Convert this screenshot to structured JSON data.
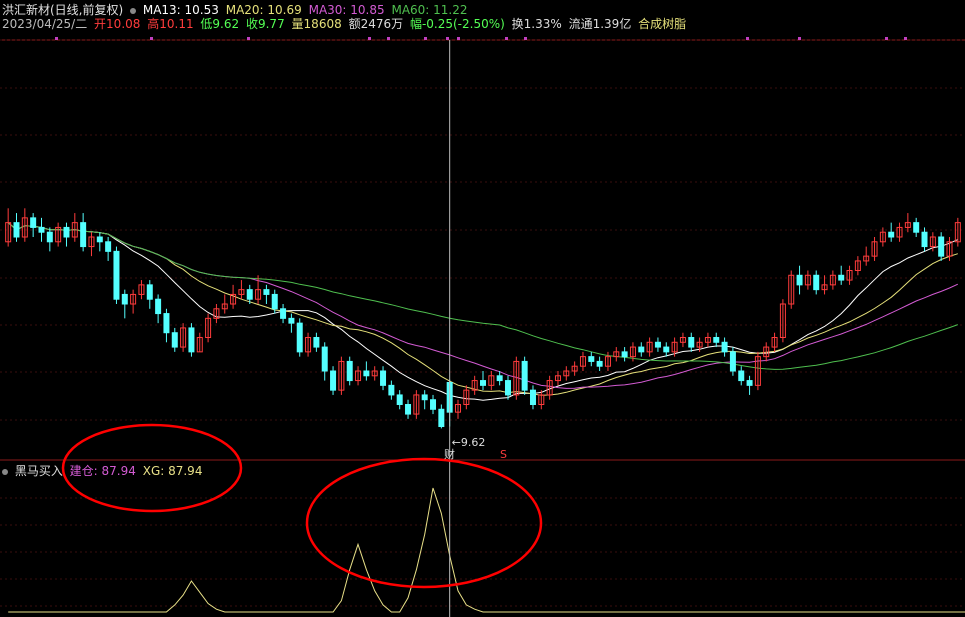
{
  "header": {
    "stock_name": "洪汇新材(日线,前复权)",
    "ma13": "MA13: 10.53",
    "ma20": "MA20: 10.69",
    "ma30": "MA30: 10.85",
    "ma60": "MA60: 11.22",
    "date": "2023/04/25/二",
    "open": "开10.08",
    "high": "高10.11",
    "low": "低9.62",
    "close": "收9.77",
    "volume": "量18608",
    "amount": "额2476万",
    "change": "幅-0.25(-2.50%)",
    "turnover": "换1.33%",
    "float_cap": "流通1.39亿",
    "industry": "合成树脂"
  },
  "markers": {
    "low_label": "←9.62",
    "marker_cai": "财",
    "marker_s": "S"
  },
  "indicator": {
    "name": "黑马买入",
    "jiancang": "建仓: 87.94",
    "xg": "XG: 87.94"
  },
  "colors": {
    "up": "#ff3c3c",
    "down": "#54ffff",
    "ma13": "#ffffff",
    "ma20": "#e5e07a",
    "ma30": "#d35bd3",
    "ma60": "#4fbf4f",
    "indicator_line": "#e8e088",
    "annotation": "#ff0000"
  },
  "chart_data": {
    "type": "candlestick",
    "price_range": [
      9.5,
      12.3
    ],
    "candles": [
      [
        11.55,
        11.75,
        11.9,
        11.5
      ],
      [
        11.75,
        11.6,
        11.85,
        11.55
      ],
      [
        11.6,
        11.8,
        11.9,
        11.55
      ],
      [
        11.8,
        11.7,
        11.85,
        11.6
      ],
      [
        11.7,
        11.65,
        11.8,
        11.55
      ],
      [
        11.65,
        11.55,
        11.7,
        11.45
      ],
      [
        11.55,
        11.7,
        11.75,
        11.5
      ],
      [
        11.7,
        11.6,
        11.75,
        11.5
      ],
      [
        11.6,
        11.75,
        11.85,
        11.55
      ],
      [
        11.75,
        11.5,
        11.85,
        11.45
      ],
      [
        11.5,
        11.6,
        11.65,
        11.4
      ],
      [
        11.6,
        11.55,
        11.65,
        11.45
      ],
      [
        11.55,
        11.45,
        11.6,
        11.35
      ],
      [
        11.45,
        10.95,
        11.5,
        10.9
      ],
      [
        11.0,
        10.9,
        11.05,
        10.75
      ],
      [
        10.9,
        11.0,
        11.05,
        10.8
      ],
      [
        11.0,
        11.1,
        11.15,
        10.95
      ],
      [
        11.1,
        10.95,
        11.15,
        10.85
      ],
      [
        10.95,
        10.8,
        11.0,
        10.7
      ],
      [
        10.8,
        10.6,
        10.85,
        10.5
      ],
      [
        10.6,
        10.45,
        10.65,
        10.4
      ],
      [
        10.45,
        10.65,
        10.7,
        10.4
      ],
      [
        10.65,
        10.4,
        10.7,
        10.35
      ],
      [
        10.4,
        10.55,
        10.6,
        10.4
      ],
      [
        10.55,
        10.75,
        10.8,
        10.5
      ],
      [
        10.75,
        10.85,
        10.9,
        10.7
      ],
      [
        10.85,
        10.9,
        11.0,
        10.8
      ],
      [
        10.9,
        11.0,
        11.1,
        10.85
      ],
      [
        11.0,
        11.05,
        11.15,
        10.95
      ],
      [
        11.05,
        10.95,
        11.1,
        10.9
      ],
      [
        10.95,
        11.05,
        11.2,
        10.9
      ],
      [
        11.05,
        11.0,
        11.1,
        10.9
      ],
      [
        11.0,
        10.85,
        11.05,
        10.8
      ],
      [
        10.85,
        10.75,
        10.9,
        10.7
      ],
      [
        10.75,
        10.7,
        10.8,
        10.6
      ],
      [
        10.7,
        10.4,
        10.75,
        10.35
      ],
      [
        10.4,
        10.55,
        10.6,
        10.35
      ],
      [
        10.55,
        10.45,
        10.6,
        10.4
      ],
      [
        10.45,
        10.2,
        10.5,
        10.1
      ],
      [
        10.2,
        10.0,
        10.25,
        9.95
      ],
      [
        10.0,
        10.3,
        10.35,
        9.95
      ],
      [
        10.3,
        10.1,
        10.35,
        10.05
      ],
      [
        10.1,
        10.2,
        10.25,
        10.05
      ],
      [
        10.2,
        10.15,
        10.3,
        10.1
      ],
      [
        10.15,
        10.2,
        10.25,
        10.1
      ],
      [
        10.2,
        10.05,
        10.25,
        10.0
      ],
      [
        10.05,
        9.95,
        10.1,
        9.9
      ],
      [
        9.95,
        9.85,
        10.0,
        9.8
      ],
      [
        9.85,
        9.75,
        9.9,
        9.7
      ],
      [
        9.75,
        9.95,
        10.0,
        9.7
      ],
      [
        9.95,
        9.9,
        10.0,
        9.8
      ],
      [
        9.9,
        9.8,
        9.95,
        9.75
      ],
      [
        9.8,
        9.62,
        9.85,
        9.6
      ],
      [
        10.08,
        9.77,
        10.11,
        9.62
      ],
      [
        9.77,
        9.85,
        9.9,
        9.7
      ],
      [
        9.85,
        10.0,
        10.05,
        9.8
      ],
      [
        10.0,
        10.1,
        10.15,
        9.95
      ],
      [
        10.1,
        10.05,
        10.2,
        10.0
      ],
      [
        10.05,
        10.15,
        10.2,
        10.0
      ],
      [
        10.15,
        10.1,
        10.2,
        10.05
      ],
      [
        10.1,
        9.95,
        10.15,
        9.9
      ],
      [
        9.95,
        10.3,
        10.35,
        9.9
      ],
      [
        10.3,
        10.0,
        10.35,
        9.95
      ],
      [
        10.0,
        9.85,
        10.05,
        9.8
      ],
      [
        9.85,
        9.95,
        10.0,
        9.8
      ],
      [
        9.95,
        10.1,
        10.15,
        9.9
      ],
      [
        10.1,
        10.15,
        10.2,
        10.05
      ],
      [
        10.15,
        10.2,
        10.25,
        10.1
      ],
      [
        10.2,
        10.25,
        10.3,
        10.15
      ],
      [
        10.25,
        10.35,
        10.4,
        10.2
      ],
      [
        10.35,
        10.3,
        10.4,
        10.25
      ],
      [
        10.3,
        10.25,
        10.35,
        10.2
      ],
      [
        10.25,
        10.35,
        10.4,
        10.2
      ],
      [
        10.35,
        10.4,
        10.45,
        10.3
      ],
      [
        10.4,
        10.35,
        10.45,
        10.3
      ],
      [
        10.35,
        10.45,
        10.5,
        10.3
      ],
      [
        10.45,
        10.4,
        10.5,
        10.35
      ],
      [
        10.4,
        10.5,
        10.55,
        10.35
      ],
      [
        10.5,
        10.45,
        10.55,
        10.4
      ],
      [
        10.45,
        10.4,
        10.5,
        10.35
      ],
      [
        10.4,
        10.5,
        10.55,
        10.35
      ],
      [
        10.5,
        10.55,
        10.6,
        10.45
      ],
      [
        10.55,
        10.45,
        10.6,
        10.4
      ],
      [
        10.45,
        10.5,
        10.55,
        10.4
      ],
      [
        10.5,
        10.55,
        10.6,
        10.45
      ],
      [
        10.55,
        10.5,
        10.6,
        10.45
      ],
      [
        10.5,
        10.4,
        10.55,
        10.35
      ],
      [
        10.4,
        10.2,
        10.45,
        10.15
      ],
      [
        10.2,
        10.1,
        10.25,
        10.05
      ],
      [
        10.1,
        10.05,
        10.15,
        9.95
      ],
      [
        10.05,
        10.35,
        10.4,
        10.0
      ],
      [
        10.35,
        10.45,
        10.5,
        10.3
      ],
      [
        10.45,
        10.55,
        10.6,
        10.4
      ],
      [
        10.55,
        10.9,
        10.95,
        10.5
      ],
      [
        10.9,
        11.2,
        11.25,
        10.85
      ],
      [
        11.2,
        11.1,
        11.3,
        11.0
      ],
      [
        11.1,
        11.2,
        11.25,
        11.05
      ],
      [
        11.2,
        11.05,
        11.25,
        11.0
      ],
      [
        11.05,
        11.1,
        11.2,
        11.0
      ],
      [
        11.1,
        11.2,
        11.25,
        11.05
      ],
      [
        11.2,
        11.15,
        11.3,
        11.1
      ],
      [
        11.15,
        11.25,
        11.3,
        11.1
      ],
      [
        11.25,
        11.35,
        11.4,
        11.2
      ],
      [
        11.35,
        11.4,
        11.5,
        11.3
      ],
      [
        11.4,
        11.55,
        11.6,
        11.35
      ],
      [
        11.55,
        11.65,
        11.7,
        11.5
      ],
      [
        11.65,
        11.6,
        11.75,
        11.55
      ],
      [
        11.6,
        11.7,
        11.75,
        11.55
      ],
      [
        11.7,
        11.75,
        11.85,
        11.65
      ],
      [
        11.75,
        11.65,
        11.8,
        11.6
      ],
      [
        11.65,
        11.5,
        11.7,
        11.45
      ],
      [
        11.5,
        11.6,
        11.65,
        11.45
      ],
      [
        11.6,
        11.4,
        11.65,
        11.35
      ],
      [
        11.4,
        11.55,
        11.6,
        11.35
      ],
      [
        11.55,
        11.75,
        11.8,
        11.5
      ]
    ],
    "indicator_values": [
      0,
      0,
      0,
      0,
      0,
      0,
      0,
      0,
      0,
      0,
      0,
      0,
      0,
      0,
      0,
      0,
      0,
      0,
      0,
      0,
      5,
      12,
      22,
      14,
      6,
      2,
      0,
      0,
      0,
      0,
      0,
      0,
      0,
      0,
      0,
      0,
      0,
      0,
      0,
      0,
      8,
      30,
      48,
      30,
      15,
      5,
      0,
      0,
      10,
      30,
      55,
      87.94,
      70,
      40,
      15,
      5,
      2,
      0,
      0,
      0,
      0,
      0,
      0,
      0,
      0,
      0,
      0,
      0,
      0,
      0,
      0,
      0,
      0,
      0,
      0,
      0,
      0,
      0,
      0,
      0,
      0,
      0,
      0,
      0,
      0,
      0,
      0,
      0,
      0,
      0,
      0,
      0,
      0,
      0,
      0,
      0,
      0,
      0,
      0,
      0,
      0,
      0,
      0,
      0,
      0,
      0,
      0,
      0,
      0,
      0,
      0,
      0,
      0,
      0,
      0,
      0,
      0
    ],
    "indicator_range": [
      0,
      95
    ]
  }
}
